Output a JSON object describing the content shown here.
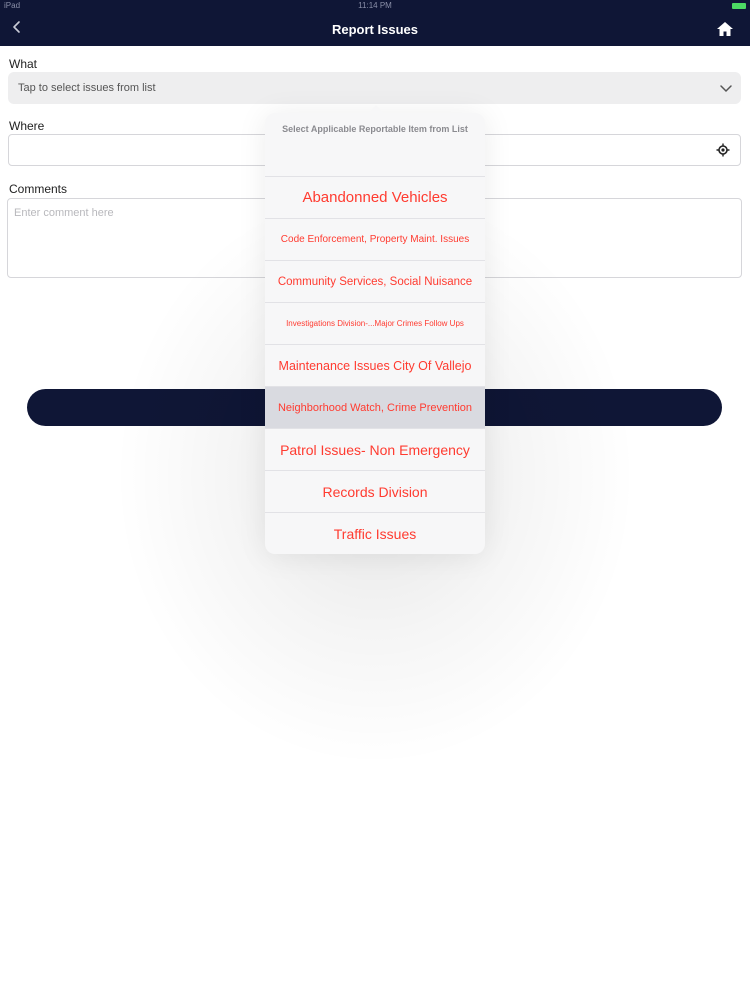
{
  "status_bar": {
    "carrier": "iPad",
    "time": "11:14 PM"
  },
  "nav": {
    "title": "Report Issues"
  },
  "form": {
    "what_label": "What",
    "what_placeholder": "Tap to select issues from list",
    "where_label": "Where",
    "where_value": "",
    "comments_label": "Comments",
    "comments_placeholder": "Enter comment here",
    "submit_label": ""
  },
  "picker": {
    "header": "Select Applicable Reportable Item from List",
    "options": [
      {
        "label": "Abandonned Vehicles",
        "selected": false
      },
      {
        "label": "Code Enforcement, Property Maint. Issues",
        "selected": false
      },
      {
        "label": "Community Services, Social Nuisance",
        "selected": false
      },
      {
        "label": "Investigations Division-...Major Crimes Follow Ups",
        "selected": false
      },
      {
        "label": "Maintenance Issues City Of Vallejo",
        "selected": false
      },
      {
        "label": "Neighborhood Watch, Crime Prevention",
        "selected": true
      },
      {
        "label": "Patrol Issues- Non Emergency",
        "selected": false
      },
      {
        "label": "Records Division",
        "selected": false
      },
      {
        "label": "Traffic Issues",
        "selected": false
      }
    ]
  },
  "colors": {
    "navbar": "#0f1636",
    "option_text": "#ff3b30",
    "selected_row": "#d9dae0"
  },
  "icons": {
    "back": "chevron-left-icon",
    "home": "home-icon",
    "dropdown": "chevron-down-icon",
    "location": "location-crosshair-icon",
    "battery": "battery-icon"
  }
}
